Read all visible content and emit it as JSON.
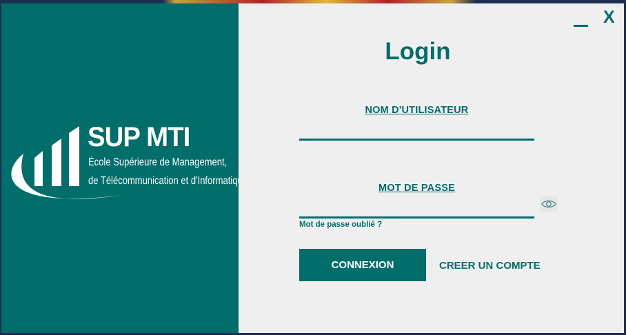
{
  "window": {
    "minimize_icon": "minimize-icon",
    "close_label": "X"
  },
  "brand": {
    "name": "SUP MTI",
    "tagline_line1": "École Supérieure de Management,",
    "tagline_line2": "de Télécommunication et d'Informatique",
    "colors": {
      "primary": "#016e6c",
      "background": "#efefef"
    }
  },
  "login": {
    "title": "Login",
    "username_label": "NOM D'UTILISATEUR",
    "username_value": "",
    "password_label": "MOT DE PASSE",
    "password_value": "",
    "show_password_icon": "eye-icon",
    "forgot_password": "Mot de passe oublié ?",
    "submit_label": "CONNEXION",
    "create_account_label": "CREER UN COMPTE"
  }
}
